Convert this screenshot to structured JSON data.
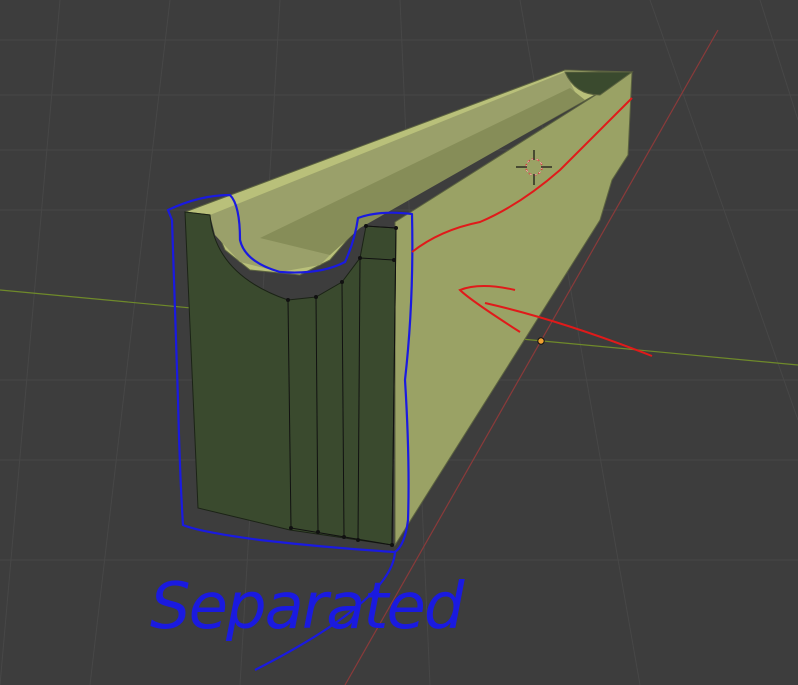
{
  "viewport": {
    "background_color": "#3d3d3d",
    "grid_color": "#474747",
    "x_axis_color": "#6f8a2a",
    "y_axis_color": "#8a3a3a"
  },
  "model": {
    "top_face_color": "#b9c07a",
    "side_face_color": "#9aa265",
    "front_face_color": "#3a4a2e",
    "groove_color": "#868d58",
    "edge_color": "#111111"
  },
  "cursor_3d": {
    "icon": "crosshair-icon",
    "color": "#d23a3a"
  },
  "origin_point": {
    "icon": "origin-dot-icon",
    "color": "#f0a030"
  },
  "annotations": {
    "separated_label": "Separated",
    "label_color": "#1a1ae0",
    "outline_color": "#1a1ae0",
    "arrow_color": "#e01a1a"
  }
}
